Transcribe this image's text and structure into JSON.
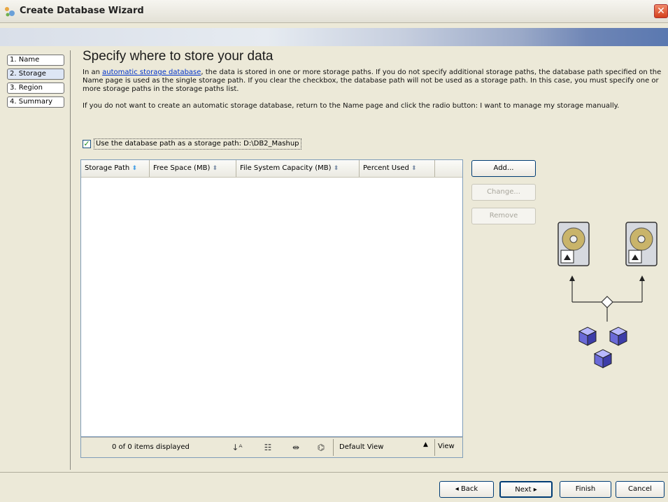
{
  "window": {
    "title": "Create Database Wizard",
    "close_glyph": "✕"
  },
  "nav": {
    "items": [
      {
        "label": "1. Name"
      },
      {
        "label": "2. Storage"
      },
      {
        "label": "3. Region"
      },
      {
        "label": "4. Summary"
      }
    ]
  },
  "page": {
    "heading": "Specify where to store your data",
    "para1_prefix": "In an ",
    "para1_link": "automatic storage database",
    "para1_rest": ", the data is stored in one or more storage paths. If you do not specify additional storage paths, the database path specified on the Name page is used as the single storage path. If you clear the checkbox, the database path will not be used as a storage path. In this case, you must specify one or more storage paths in the storage paths list.",
    "para2": "If you do not want to create an automatic storage database, return to the Name page and click the radio button: I want to manage my storage manually.",
    "checkbox_label": "Use the database path as a storage path: D:\\DB2_Mashup",
    "checkbox_checked": true
  },
  "table": {
    "columns": [
      {
        "label": "Storage Path",
        "sort": "⬍"
      },
      {
        "label": "Free Space (MB)",
        "sort": "⬍"
      },
      {
        "label": "File System Capacity (MB)",
        "sort": "⬍"
      },
      {
        "label": "Percent Used",
        "sort": "⬍"
      }
    ],
    "rows": [],
    "footer": {
      "items_displayed": "0 of 0 items displayed",
      "view_select": "Default View",
      "view_button": "View"
    }
  },
  "side_buttons": {
    "add": "Add...",
    "change": "Change...",
    "remove": "Remove"
  },
  "bottom_buttons": {
    "back": "◂ Back",
    "next": "Next ▸",
    "finish": "Finish",
    "cancel": "Cancel"
  },
  "icons": {
    "title": "wizard-icon",
    "sort_az": "sort-icon",
    "filter": "filter-icon",
    "columns": "columns-icon",
    "find": "binoculars-icon"
  },
  "colors": {
    "link": "#0033cc",
    "accent_border": "#7f9db9"
  }
}
